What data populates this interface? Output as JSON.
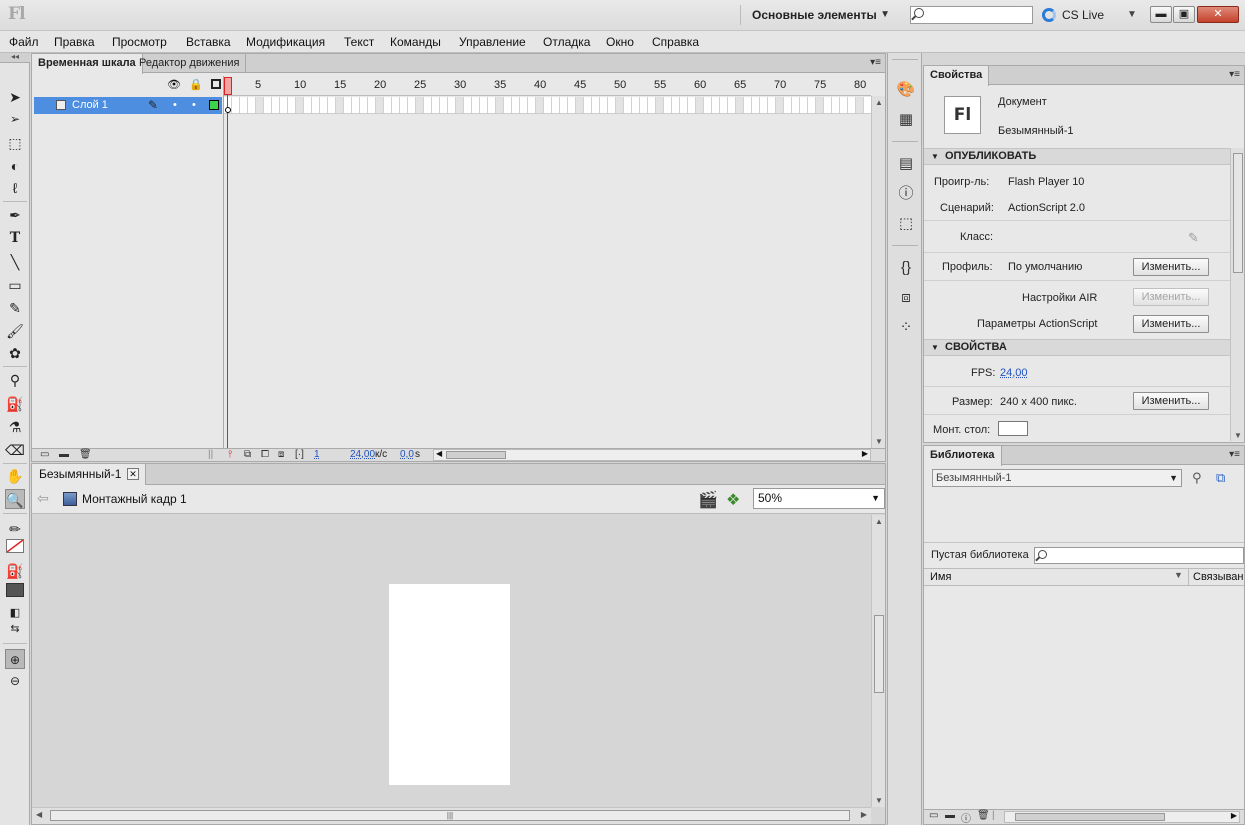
{
  "app": {
    "logo": "Fl",
    "workspace": "Основные элементы",
    "search_value": "",
    "cs_live": "CS Live",
    "window_buttons": {
      "minimize": "▬",
      "maximize": "▣",
      "close": "✕"
    }
  },
  "menu": [
    "Файл",
    "Правка",
    "Просмотр",
    "Вставка",
    "Модификация",
    "Текст",
    "Команды",
    "Управление",
    "Отладка",
    "Окно",
    "Справка"
  ],
  "timeline": {
    "tabs": [
      "Временная шкала",
      "Редактор движения"
    ],
    "layer_name": "Слой 1",
    "ruler_ticks": [
      "1",
      "5",
      "10",
      "15",
      "20",
      "25",
      "30",
      "35",
      "40",
      "45",
      "50",
      "55",
      "60",
      "65",
      "70",
      "75",
      "80"
    ],
    "current_frame": "1",
    "fps": "24,00",
    "fps_unit": "к/с",
    "time": "0,0",
    "time_unit": "s"
  },
  "document": {
    "tab": "Безымянный-1",
    "scene": "Монтажный кадр 1",
    "zoom": "50%"
  },
  "properties": {
    "tab": "Свойства",
    "doc_icon": "Fl",
    "doc_type": "Документ",
    "doc_name": "Безымянный-1",
    "publish_header": "ОПУБЛИКОВАТЬ",
    "player_label": "Проигр-ль:",
    "player_value": "Flash Player 10",
    "script_label": "Сценарий:",
    "script_value": "ActionScript 2.0",
    "class_label": "Класс:",
    "profile_label": "Профиль:",
    "profile_value": "По умолчанию",
    "change_btn": "Изменить...",
    "air_label": "Настройки AIR",
    "as_params_label": "Параметры ActionScript",
    "props_header": "СВОЙСТВА",
    "fps_label": "FPS:",
    "fps_value": "24,00",
    "size_label": "Размер:",
    "size_value": "240 x 400 пикс.",
    "stage_label": "Монт. стол:"
  },
  "library": {
    "tab": "Библиотека",
    "doc_select": "Безымянный-1",
    "empty_text": "Пустая библиотека",
    "search_value": "",
    "col_name": "Имя",
    "col_link": "Связыван"
  }
}
